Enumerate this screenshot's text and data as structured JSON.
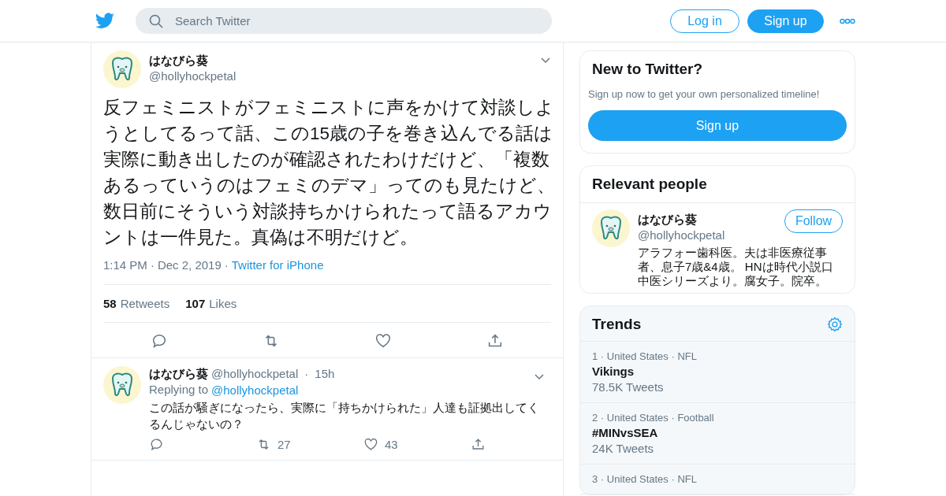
{
  "header": {
    "search": {
      "placeholder": "Search Twitter"
    },
    "login": "Log in",
    "signup": "Sign up"
  },
  "tweet": {
    "name": "はなびら葵",
    "handle": "@hollyhockpetal",
    "text": "反フェミニストがフェミニストに声をかけて対談しようとしてるって話、この15歳の子を巻き込んでる話は実際に動き出したのが確認されたわけだけど、「複数あるっていうのはフェミのデマ」ってのも見たけど、数日前にそういう対談持ちかけられたって語るアカウントは一件見た。真偽は不明だけど。",
    "time": "1:14 PM",
    "separator": "·",
    "date": "Dec 2, 2019",
    "source": "Twitter for iPhone",
    "retweets": "58",
    "retweets_label": "Retweets",
    "likes": "107",
    "likes_label": "Likes"
  },
  "reply": {
    "name": "はなびら葵",
    "handle": "@hollyhockpetal",
    "separator": "·",
    "age": "15h",
    "replying_label": "Replying to",
    "replying_to": "@hollyhockpetal",
    "text": "この話が騒ぎになったら、実際に「持ちかけられた」人達も証拠出してくるんじゃないの？",
    "retweets": "27",
    "likes": "43"
  },
  "new_to_twitter": {
    "title": "New to Twitter?",
    "subtitle": "Sign up now to get your own personalized timeline!",
    "button": "Sign up"
  },
  "relevant_people": {
    "title": "Relevant people",
    "people": [
      {
        "name": "はなびら葵",
        "handle": "@hollyhockpetal",
        "follow": "Follow",
        "bio": "アラフォー歯科医。夫は非医療従事者、息子7歳&4歳。 HNは時代小説口中医シリーズより。腐女子。院卒。"
      }
    ]
  },
  "trends": {
    "title": "Trends",
    "items": [
      {
        "context": "1 · United States · NFL",
        "name": "Vikings",
        "count": "78.5K Tweets"
      },
      {
        "context": "2 · United States · Football",
        "name": "#MINvsSEA",
        "count": "24K Tweets"
      },
      {
        "context": "3 · United States · NFL"
      }
    ]
  }
}
